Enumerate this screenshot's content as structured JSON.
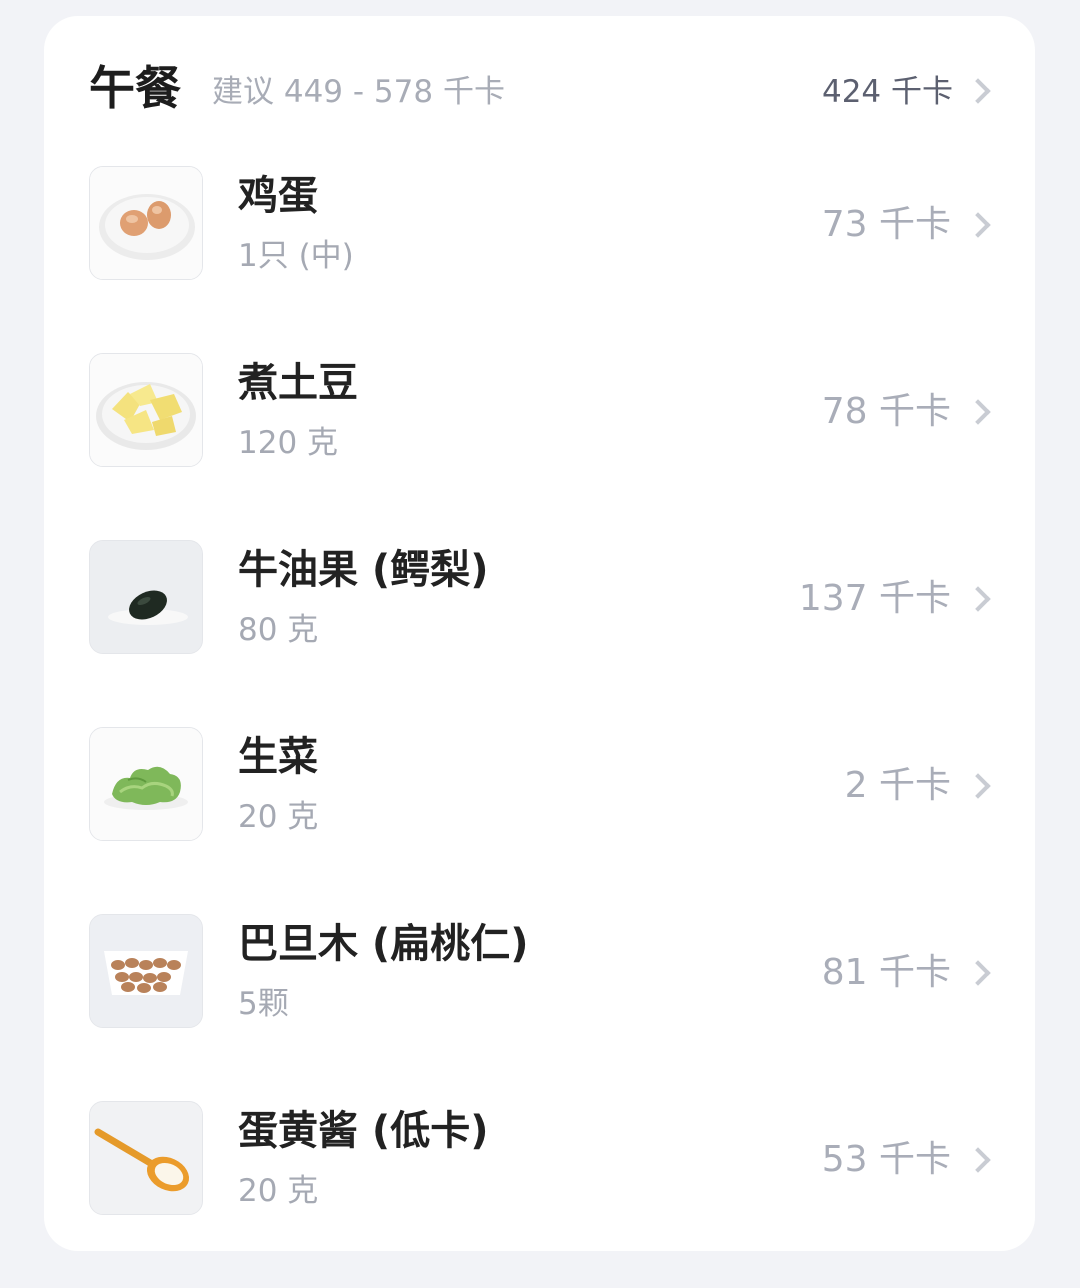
{
  "meal": {
    "title": "午餐",
    "suggestion": "建议 449 - 578 千卡",
    "total": "424 千卡"
  },
  "items": [
    {
      "name": "鸡蛋",
      "amount": "1只 (中)",
      "kcal": "73 千卡",
      "icon": "egg-thumbnail"
    },
    {
      "name": "煮土豆",
      "amount": "120 克",
      "kcal": "78 千卡",
      "icon": "potato-thumbnail"
    },
    {
      "name": "牛油果 (鳄梨)",
      "amount": "80 克",
      "kcal": "137 千卡",
      "icon": "avocado-thumbnail"
    },
    {
      "name": "生菜",
      "amount": "20 克",
      "kcal": "2 千卡",
      "icon": "lettuce-thumbnail"
    },
    {
      "name": "巴旦木 (扁桃仁)",
      "amount": "5颗",
      "kcal": "81 千卡",
      "icon": "almond-thumbnail"
    },
    {
      "name": "蛋黄酱 (低卡)",
      "amount": "20 克",
      "kcal": "53 千卡",
      "icon": "mayonnaise-thumbnail"
    }
  ]
}
